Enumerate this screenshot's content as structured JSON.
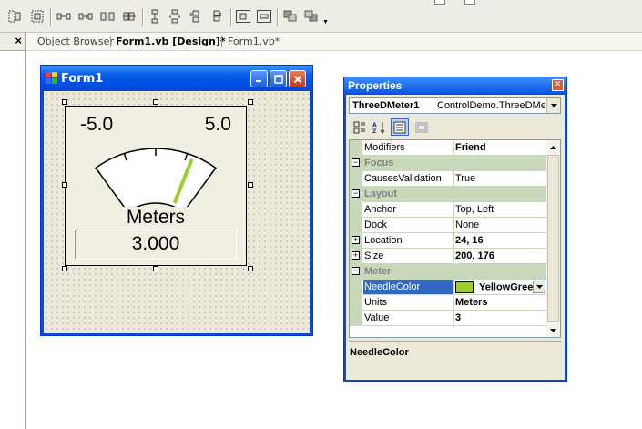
{
  "doc_tabs": [
    {
      "label": "Object Browser",
      "active": false
    },
    {
      "label": "Form1.vb [Design]*",
      "active": true
    },
    {
      "label": "Form1.vb*",
      "active": false
    }
  ],
  "left_panel": {
    "close_label": "×"
  },
  "form": {
    "title": "Form1",
    "meter": {
      "min_label": "-5.0",
      "max_label": "5.0",
      "units": "Meters",
      "value_text": "3.000",
      "min": -5.0,
      "max": 5.0,
      "value": 3.0,
      "needle_color": "#9acd32"
    }
  },
  "properties": {
    "title": "Properties",
    "object_name": "ThreeDMeter1",
    "object_type": "ControlDemo.ThreeDMeter",
    "rows": [
      {
        "kind": "prop",
        "name": "Modifiers",
        "value": "Friend",
        "bold": true
      },
      {
        "kind": "cat",
        "name": "Focus"
      },
      {
        "kind": "prop",
        "name": "CausesValidation",
        "value": "True"
      },
      {
        "kind": "cat",
        "name": "Layout"
      },
      {
        "kind": "prop",
        "name": "Anchor",
        "value": "Top, Left"
      },
      {
        "kind": "prop",
        "name": "Dock",
        "value": "None"
      },
      {
        "kind": "prop",
        "name": "Location",
        "value": "24, 16",
        "bold": true,
        "expandable": true
      },
      {
        "kind": "prop",
        "name": "Size",
        "value": "200, 176",
        "bold": true,
        "expandable": true
      },
      {
        "kind": "cat",
        "name": "Meter"
      },
      {
        "kind": "prop",
        "name": "NeedleColor",
        "value": "YellowGreen",
        "bold": true,
        "selected": true,
        "swatch": "#9acd32"
      },
      {
        "kind": "prop",
        "name": "Units",
        "value": "Meters",
        "bold": true
      },
      {
        "kind": "prop",
        "name": "Value",
        "value": "3",
        "bold": true
      }
    ],
    "description_name": "NeedleColor"
  }
}
